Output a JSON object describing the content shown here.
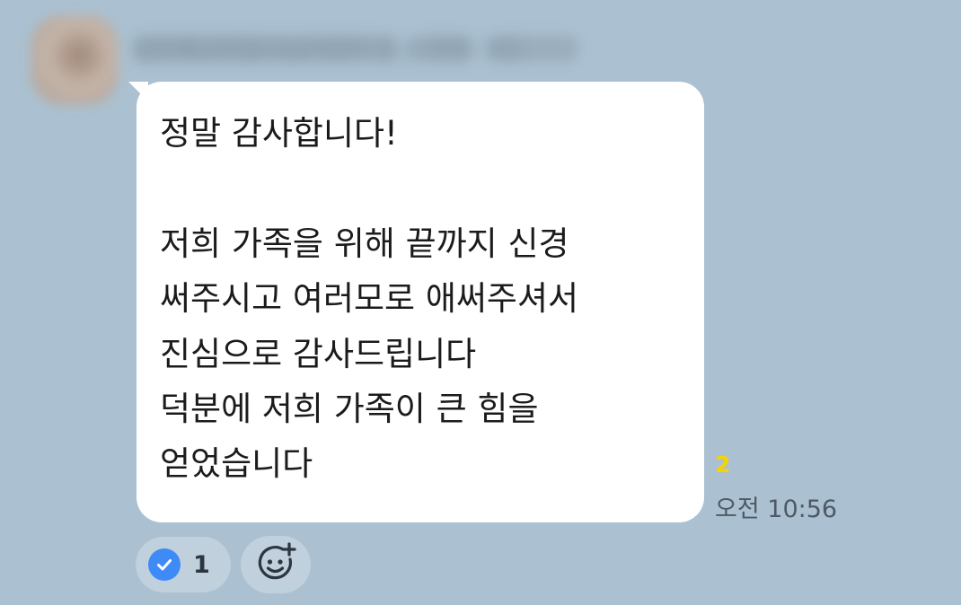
{
  "sender": {
    "name": "김민혜교회집사님이었어 얼는 추천 사다"
  },
  "message": {
    "text": "정말 감사합니다!\n\n저희 가족을 위해 끝까지 신경\n써주시고 여러모로 애써주셔서\n진심으로 감사드립니다\n덕분에 저희 가족이 큰 힘을\n얻었습니다",
    "unread_count": "2",
    "time": "오전 10:56"
  },
  "reactions": {
    "check_count": "1",
    "check_icon": "check-circle-icon",
    "add_icon": "add-emoji-icon"
  },
  "colors": {
    "background": "#abc1d1",
    "bubble": "#ffffff",
    "unread": "#f5d400",
    "check": "#3e8af7"
  }
}
